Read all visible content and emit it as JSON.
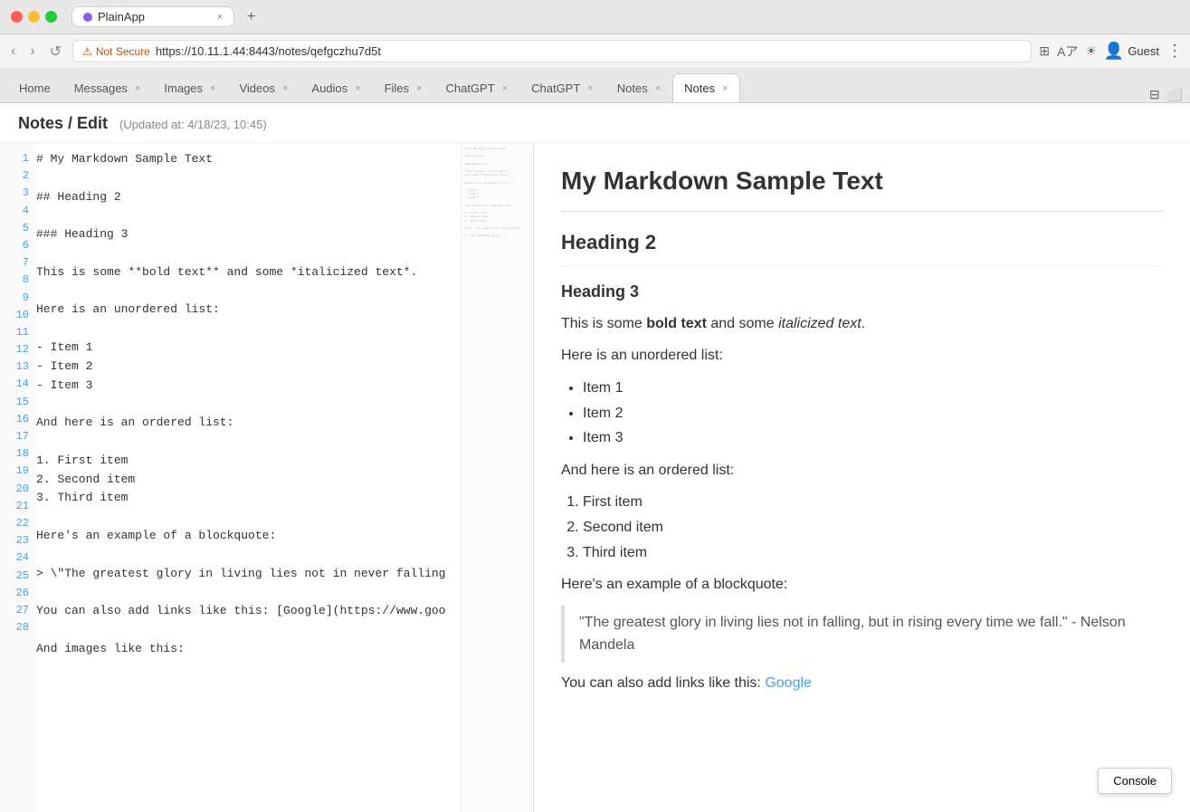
{
  "titlebar": {
    "app_name": "PlainApp",
    "tab_close": "×",
    "new_tab": "+"
  },
  "navbar": {
    "back": "‹",
    "forward": "›",
    "refresh": "↺",
    "security_label": "Not Secure",
    "url": "https://10.11.1.44:8443/notes/qefgczhu7d5t",
    "guest_label": "Guest",
    "extension_icon": "⊞",
    "translate_icon": "Aa",
    "theme_icon": "☀",
    "profile_icon": "⊕",
    "more_icon": "⋮"
  },
  "browser_tabs": [
    {
      "label": "Home",
      "closable": false,
      "active": false
    },
    {
      "label": "Messages",
      "closable": true,
      "active": false
    },
    {
      "label": "Images",
      "closable": true,
      "active": false
    },
    {
      "label": "Videos",
      "closable": true,
      "active": false
    },
    {
      "label": "Audios",
      "closable": true,
      "active": false
    },
    {
      "label": "Files",
      "closable": true,
      "active": false
    },
    {
      "label": "ChatGPT",
      "closable": true,
      "active": false
    },
    {
      "label": "ChatGPT",
      "closable": true,
      "active": false
    },
    {
      "label": "Notes",
      "closable": true,
      "active": false
    },
    {
      "label": "Notes",
      "closable": true,
      "active": true
    }
  ],
  "page_header": {
    "breadcrumb": "Notes / Edit",
    "updated": "(Updated at: 4/18/23, 10:45)"
  },
  "editor": {
    "lines": [
      "# My Markdown Sample Text",
      "",
      "## Heading 2",
      "",
      "### Heading 3",
      "",
      "This is some **bold text** and some *italicized text*.",
      "",
      "Here is an unordered list:",
      "",
      "- Item 1",
      "- Item 2",
      "- Item 3",
      "",
      "And here is an ordered list:",
      "",
      "1. First item",
      "2. Second item",
      "3. Third item",
      "",
      "Here's an example of a blockquote:",
      "",
      "> \\\"The greatest glory in living lies not in never falling",
      "",
      "You can also add links like this: [Google](https://www.goo",
      "",
      "And images like this:",
      ""
    ]
  },
  "preview": {
    "h1": "My Markdown Sample Text",
    "h2": "Heading 2",
    "h3": "Heading 3",
    "para1_prefix": "This is some ",
    "para1_bold": "bold text",
    "para1_mid": " and some ",
    "para1_italic": "italicized text",
    "para1_suffix": ".",
    "unordered_intro": "Here is an unordered list:",
    "unordered_items": [
      "Item 1",
      "Item 2",
      "Item 3"
    ],
    "ordered_intro": "And here is an ordered list:",
    "ordered_items": [
      "First item",
      "Second item",
      "Third item"
    ],
    "blockquote_intro": "Here's an example of a blockquote:",
    "blockquote_text": "\"The greatest glory in living lies not in falling, but in rising every time we fall.\" - Nelson Mandela",
    "link_prefix": "You can also add links like this: ",
    "link_text": "Google",
    "link_href": "https://www.google.com"
  },
  "console_btn_label": "Console"
}
